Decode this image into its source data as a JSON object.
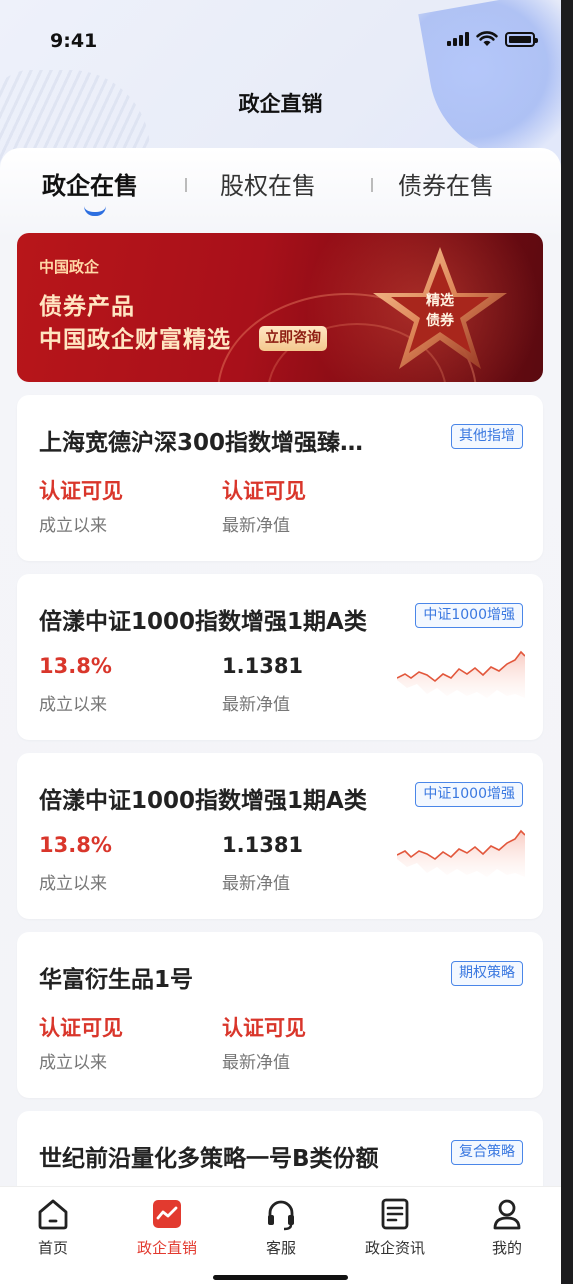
{
  "status": {
    "time": "9:41"
  },
  "nav": {
    "title": "政企直销"
  },
  "tabs": [
    {
      "label": "政企在售",
      "active": true
    },
    {
      "label": "股权在售",
      "active": false
    },
    {
      "label": "债券在售",
      "active": false
    }
  ],
  "banner": {
    "tag": "中国政企",
    "line1": "债券产品",
    "line2": "中国政企财富精选",
    "button": "立即咨询",
    "star_line1": "精选",
    "star_line2": "债券"
  },
  "products": [
    {
      "title": "上海宽德沪深300指数增强臻…",
      "badge": "其他指增",
      "value1": "认证可见",
      "value2": "认证可见",
      "label1": "成立以来",
      "label2": "最新净值",
      "has_chart": false
    },
    {
      "title": "倍漾中证1000指数增强1期A类",
      "badge": "中证1000增强",
      "value1": "13.8%",
      "value2": "1.1381",
      "label1": "成立以来",
      "label2": "最新净值",
      "has_chart": true
    },
    {
      "title": "倍漾中证1000指数增强1期A类",
      "badge": "中证1000增强",
      "value1": "13.8%",
      "value2": "1.1381",
      "label1": "成立以来",
      "label2": "最新净值",
      "has_chart": true
    },
    {
      "title": "华富衍生品1号",
      "badge": "期权策略",
      "value1": "认证可见",
      "value2": "认证可见",
      "label1": "成立以来",
      "label2": "最新净值",
      "has_chart": false
    },
    {
      "title": "世纪前沿量化多策略一号B类份额",
      "badge": "复合策略"
    }
  ],
  "tabbar": [
    {
      "label": "首页",
      "icon": "home-icon",
      "active": false
    },
    {
      "label": "政企直销",
      "icon": "trend-chart-icon",
      "active": true
    },
    {
      "label": "客服",
      "icon": "headset-icon",
      "active": false
    },
    {
      "label": "政企资讯",
      "icon": "news-icon",
      "active": false
    },
    {
      "label": "我的",
      "icon": "user-icon",
      "active": false
    }
  ],
  "colors": {
    "accent_red": "#e23a2f",
    "value_red": "#d9362b",
    "badge_blue": "#3a78e0",
    "tab_indicator": "#2d6fe0"
  }
}
